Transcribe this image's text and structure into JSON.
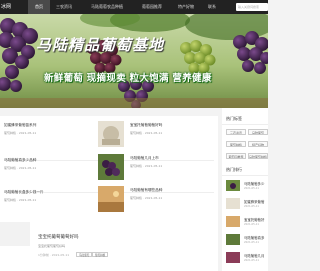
{
  "nav": {
    "logo": "冰网",
    "items": [
      "首页",
      "三农资讯",
      "马陆葡萄农品种植",
      "葡萄园推荐",
      "特产好物",
      "联系"
    ],
    "search_placeholder": "输入关键词搜索"
  },
  "banner": {
    "title": "马陆精品葡萄基地",
    "slogan": "新鲜葡萄 现摘现卖 粒大饱满 营养健康"
  },
  "articles": [
    {
      "title": "如蜜蜂采葡萄苗系列",
      "meta": "葡萄种植 · 2021-05-11"
    },
    {
      "title": "宝宝托葡萄葡萄好吗",
      "meta": "葡萄种植 · 2021-05-11"
    },
    {
      "title": "马陆葡萄真多少品种",
      "meta": "葡萄种植 · 2021-05-11"
    },
    {
      "title": "马陆葡萄几月上市",
      "meta": "葡萄种植 · 2021-05-11"
    },
    {
      "title": "马陆葡萄长盒多少钱一斤",
      "meta": "葡萄种植 · 2021-05-11"
    },
    {
      "title": "马陆葡萄有哪些品种",
      "meta": "葡萄种植 · 2021-05-11"
    }
  ],
  "featured": {
    "title": "宝宝托葡萄葡萄好吗",
    "desc": "宝宝托葡萄葡萄好吗",
    "meta": "1分钟前 · 2021-05-11",
    "tag1": "马陆葡萄",
    "tag2": "葡萄种植"
  },
  "sidebar": {
    "tags_title": "热门标签",
    "tags": [
      "三农资讯",
      "马陆葡萄",
      "葡萄种植",
      "特产好物",
      "葡萄园推荐",
      "马陆葡萄种植"
    ],
    "rank_title": "热门排行",
    "ranks": [
      {
        "title": "马陆葡萄多少",
        "date": "2021-05-11"
      },
      {
        "title": "如蜜蜂采葡萄",
        "date": "2021-05-11"
      },
      {
        "title": "宝宝托葡萄好",
        "date": "2021-05-11"
      },
      {
        "title": "马陆葡萄真多",
        "date": "2021-05-11"
      },
      {
        "title": "马陆葡萄几月",
        "date": "2021-05-11"
      }
    ]
  }
}
